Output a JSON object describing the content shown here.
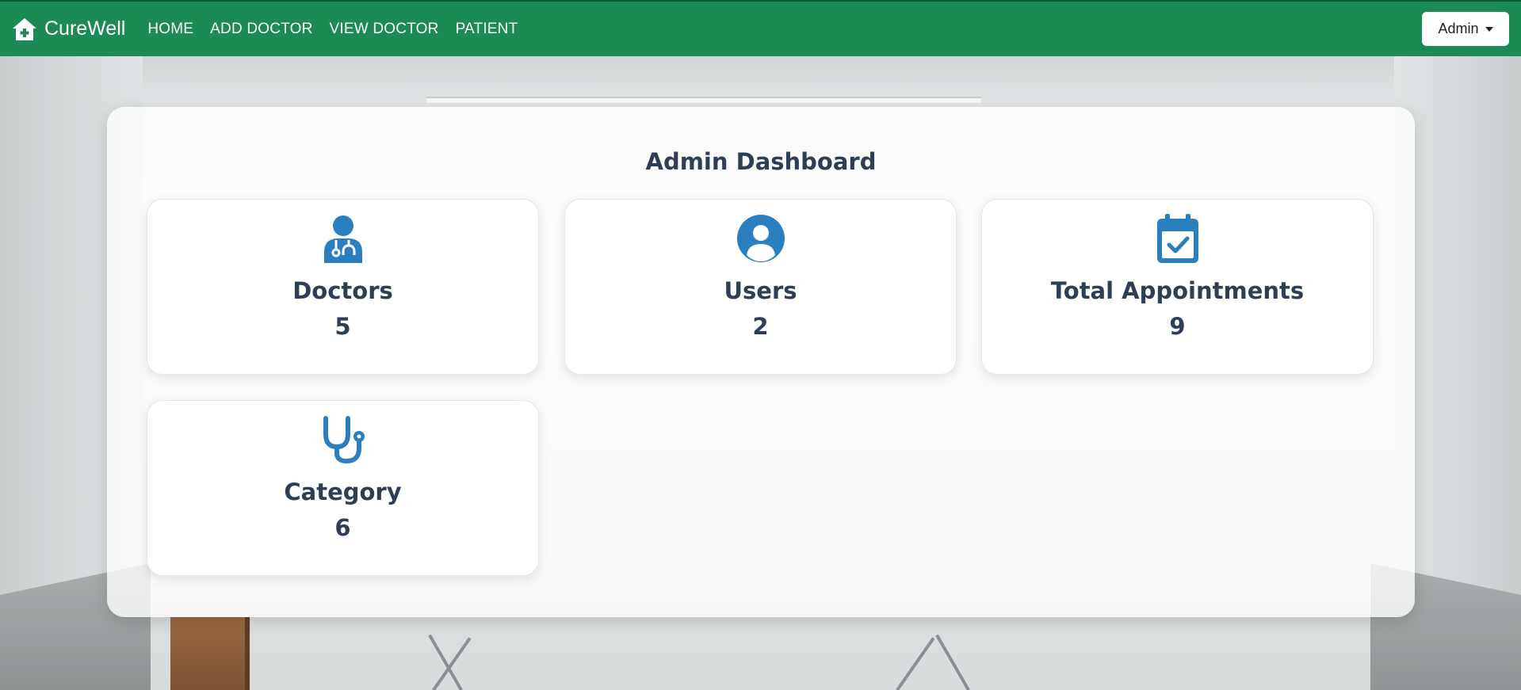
{
  "navbar": {
    "brand": "CureWell",
    "links": [
      "HOME",
      "ADD DOCTOR",
      "VIEW DOCTOR",
      "PATIENT"
    ],
    "user_menu_label": "Admin",
    "bg_color": "#1b8a55"
  },
  "dashboard": {
    "title": "Admin Dashboard",
    "cards": [
      {
        "label": "Doctors",
        "count": "5",
        "icon": "doctor-icon"
      },
      {
        "label": "Users",
        "count": "2",
        "icon": "user-circle-icon"
      },
      {
        "label": "Total Appointments",
        "count": "9",
        "icon": "calendar-check-icon"
      },
      {
        "label": "Category",
        "count": "6",
        "icon": "stethoscope-icon"
      }
    ],
    "icon_color": "#2b7fbf",
    "text_color": "#2e3e55"
  }
}
